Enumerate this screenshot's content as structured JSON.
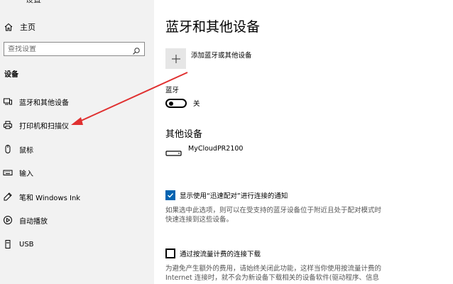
{
  "window": {
    "title": "设置",
    "back_glyph": "←"
  },
  "sidebar": {
    "home_label": "主页",
    "search_placeholder": "查找设置",
    "section_label": "设备",
    "items": [
      {
        "label": "蓝牙和其他设备",
        "icon": "bluetooth-devices-icon"
      },
      {
        "label": "打印机和扫描仪",
        "icon": "printer-icon"
      },
      {
        "label": "鼠标",
        "icon": "mouse-icon"
      },
      {
        "label": "输入",
        "icon": "keyboard-icon"
      },
      {
        "label": "笔和 Windows Ink",
        "icon": "pen-icon"
      },
      {
        "label": "自动播放",
        "icon": "autoplay-icon"
      },
      {
        "label": "USB",
        "icon": "usb-icon"
      }
    ]
  },
  "main": {
    "title": "蓝牙和其他设备",
    "add_device_label": "添加蓝牙或其他设备",
    "bluetooth_label": "蓝牙",
    "bluetooth_state": "关",
    "other_devices_title": "其他设备",
    "devices": [
      {
        "name": "MyCloudPR2100",
        "icon": "network-drive-icon"
      }
    ],
    "swift_pair": {
      "checked": true,
      "label": "显示使用“迅速配对”进行连接的通知",
      "description": [
        "如果选中此选项，则可以在受支持的蓝牙设备位于附近且处于配对模式时",
        "快速连接到这些设备。"
      ]
    },
    "metered": {
      "checked": false,
      "label": "通过按流量计费的连接下载",
      "description": [
        "为避免产生额外的费用，请始终关闭此功能，这样当你使用按流量计费的",
        "Internet 连接时，就不会为新设备下载相关的设备软件(驱动程序、信息"
      ]
    }
  },
  "colors": {
    "sidebar_bg": "#f2f2f2",
    "accent": "#0063b1",
    "annotation_arrow": "#e03030"
  }
}
